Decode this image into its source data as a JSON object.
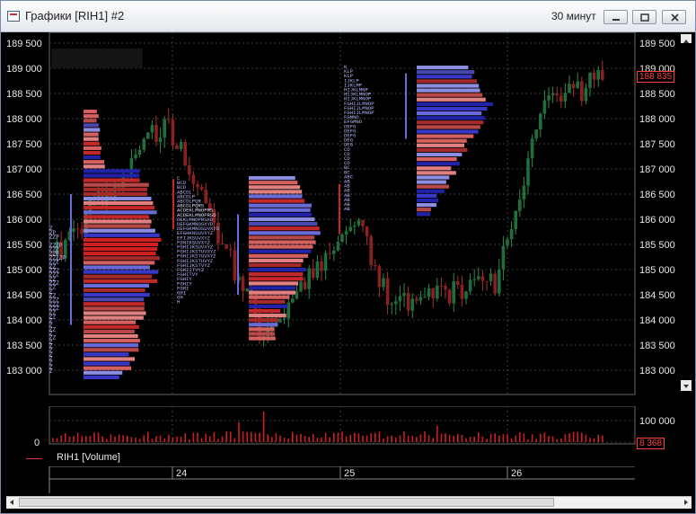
{
  "window": {
    "title": "Графики [RIH1] #2",
    "timeframe": "30 минут",
    "colors": {
      "background": "#000000",
      "grid": "#3c3c3c",
      "bull": "#1e6b3a",
      "bear": "#8a1f1f",
      "volume": "#cc2020",
      "profile_red": "#c42828",
      "profile_blue": "#3838c8",
      "current": "#ff4040"
    }
  },
  "icons": {
    "app": "chart-app-icon",
    "minimize": "minimize-icon",
    "maximize": "maximize-icon",
    "close": "close-icon"
  },
  "price_axis": {
    "ticks": [
      "189 500",
      "189 000",
      "188 500",
      "188 000",
      "187 500",
      "187 000",
      "186 500",
      "186 000",
      "185 500",
      "185 000",
      "184 500",
      "184 000",
      "183 500",
      "183 000"
    ],
    "current_value": "188 835"
  },
  "volume_axis": {
    "ticks": [
      "100 000",
      "0"
    ],
    "current_value": "8 368"
  },
  "volume_legend": "RIH1 [Volume]",
  "time_axis": {
    "labels": [
      "24",
      "25",
      "26"
    ]
  },
  "profiles": [
    {
      "levels": [
        185840,
        185750,
        185670,
        185500,
        185420,
        185330,
        185250,
        185170,
        185080,
        185000,
        184920,
        184830,
        184750,
        184670,
        184580,
        184500,
        184420,
        184330,
        184250,
        184170,
        184080,
        184000,
        183920,
        183830,
        183750,
        183670,
        183580,
        183500,
        183420,
        183330,
        183250,
        183170,
        183080,
        183000
      ],
      "rows": [
        "Z",
        "ZP",
        "ZZP",
        "ZZZP",
        "ZZZ",
        "ZZP",
        "ZZZZP",
        "ZZZ",
        "ZZ",
        "ZZZ",
        "ZZZ",
        "ZZ",
        "ZZZ",
        "ZZ",
        "Z",
        "ZZ",
        "ZZZ",
        "ZZZ",
        "ZZZ",
        "ZZ",
        "ZZ",
        "Z",
        "Z",
        "ZZ",
        "Z",
        "ZZ",
        "Z",
        "Z",
        "Z",
        "Z",
        "Z",
        "Z",
        "Z",
        "Z"
      ]
    }
  ],
  "tpo_columns": [
    {
      "id": "col-24",
      "rows": [
        "C",
        "BCD",
        "BCD",
        "ABCDL",
        "ABCDLP",
        "ABCDLPQR",
        "ABCDLPQRS",
        "ACDEKLMNOPRS",
        "ACDEKLMNOPRSD",
        "DEKLMNOPRSXD",
        "DEFGKMNOSXYD",
        "DEFGKMNOSUVXYD",
        "EFGHKNSUVXYZ",
        "EFIJKSUVXYZ",
        "FGHIKSUVXYZ",
        "FGHIJKSUVXYZ",
        "FGHIJKSTUVXYZ",
        "FGHIJKSTUVXYZ",
        "FGHIJKSTUVYZ",
        "FGHIJKSTVYZ",
        "FGHIJTVYZ",
        "FGHITVY",
        "FGHIY",
        "FGHIY",
        "FGHI",
        "GHI",
        "GH",
        "H"
      ]
    },
    {
      "id": "col-25",
      "rows": [
        "K",
        "KLP",
        "KLP",
        "IJKLP",
        "IJKLMP",
        "HIJKLMNP",
        "HIJKLMNOP",
        "HIJKLMNOP",
        "FGHIJLMNOP",
        "FGHIJLMNOP",
        "FGHIJLMNOP",
        "FGMNO",
        "EFGMNO",
        "DEFG",
        "DEFG",
        "DEFG",
        "DEG",
        "DEG",
        "CD",
        "CD",
        "CD",
        "CD",
        "BC",
        "BC",
        "ABC",
        "AB",
        "AB",
        "AB",
        "AB",
        "AB",
        "AB",
        "AB"
      ]
    }
  ]
}
